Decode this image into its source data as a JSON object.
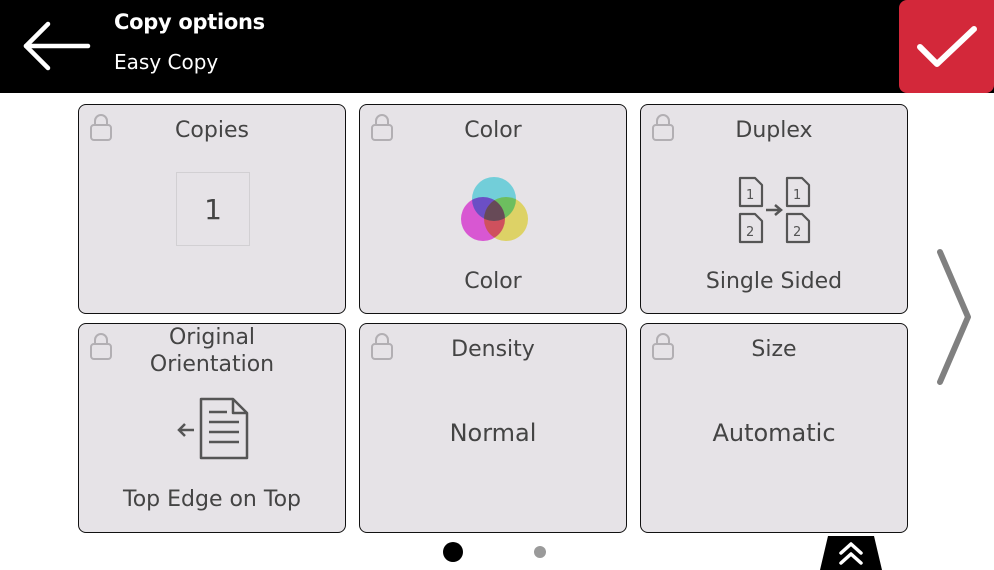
{
  "header": {
    "title": "Copy options",
    "subtitle": "Easy Copy",
    "back_icon": "arrow-left-icon",
    "confirm_icon": "checkmark-icon",
    "confirm_color": "#d3283a"
  },
  "tiles": {
    "copies": {
      "title": "Copies",
      "value": "1",
      "icon": "lock-icon"
    },
    "color": {
      "title": "Color",
      "value": "Color",
      "icon": "color-circles-icon"
    },
    "duplex": {
      "title": "Duplex",
      "value": "Single Sided",
      "icon": "duplex-pages-icon"
    },
    "orientation": {
      "title": "Original\nOrientation",
      "value": "Top Edge on Top",
      "icon": "document-orientation-icon"
    },
    "density": {
      "title": "Density",
      "value": "Normal"
    },
    "size": {
      "title": "Size",
      "value": "Automatic"
    }
  },
  "pagination": {
    "current_page": 1,
    "total_pages": 2
  },
  "navigation": {
    "next_icon": "chevron-right-icon",
    "collapse_icon": "double-chevron-up-icon"
  },
  "colors": {
    "header_bg": "#000000",
    "tile_bg": "#e6e3e7",
    "text": "#444444"
  }
}
